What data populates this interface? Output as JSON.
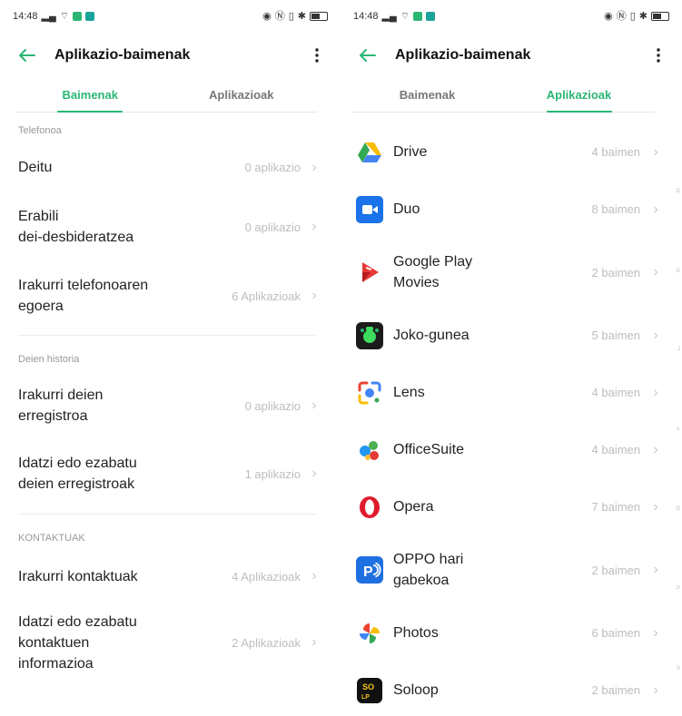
{
  "left": {
    "status": {
      "time": "14:48"
    },
    "appbar": {
      "title": "Aplikazio-baimenak"
    },
    "tabs": [
      {
        "label": "Baimenak",
        "active": true
      },
      {
        "label": "Aplikazioak",
        "active": false
      }
    ],
    "sections": [
      {
        "header": "Telefonoa",
        "items": [
          {
            "label": "Deitu",
            "value": "0 aplikazio"
          },
          {
            "label": "Erabili\ndei-desbideratzea",
            "value": "0 aplikazio"
          },
          {
            "label": "Irakurri telefonoaren\negoera",
            "value": "6 Aplikazioak"
          }
        ]
      },
      {
        "header": "Deien historia",
        "items": [
          {
            "label": "Irakurri deien\nerregistroa",
            "value": "0 aplikazio"
          },
          {
            "label": "Idatzi edo ezabatu\ndeien erregistroak",
            "value": "1 aplikazio"
          }
        ]
      },
      {
        "header": "KONTAKTUAK",
        "items": [
          {
            "label": "Irakurri kontaktuak",
            "value": "4 Aplikazioak"
          },
          {
            "label": "Idatzi edo ezabatu\nkontaktuen\ninformazioa",
            "value": "2 Aplikazioak"
          }
        ]
      }
    ]
  },
  "right": {
    "status": {
      "time": "14:48"
    },
    "appbar": {
      "title": "Aplikazio-baimenak"
    },
    "tabs": [
      {
        "label": "Baimenak",
        "active": false
      },
      {
        "label": "Aplikazioak",
        "active": true
      }
    ],
    "apps": [
      {
        "name": "Drive",
        "value": "4 baimen",
        "icon": "drive-icon"
      },
      {
        "name": "Duo",
        "value": "8 baimen",
        "icon": "duo-icon"
      },
      {
        "name": "Google Play\nMovies",
        "value": "2 baimen",
        "icon": "play-movies-icon"
      },
      {
        "name": "Joko-gunea",
        "value": "5 baimen",
        "icon": "joko-gunea-icon"
      },
      {
        "name": "Lens",
        "value": "4 baimen",
        "icon": "lens-icon"
      },
      {
        "name": "OfficeSuite",
        "value": "4 baimen",
        "icon": "officesuite-icon"
      },
      {
        "name": "Opera",
        "value": "7 baimen",
        "icon": "opera-icon"
      },
      {
        "name": "OPPO hari\ngabekoa",
        "value": "2 baimen",
        "icon": "oppo-wireless-icon"
      },
      {
        "name": "Photos",
        "value": "6 baimen",
        "icon": "photos-icon"
      },
      {
        "name": "Soloop",
        "value": "2 baimen",
        "icon": "soloop-icon"
      }
    ],
    "index_letters": [
      "D",
      "G",
      "J",
      "L",
      "O",
      "P",
      "S"
    ]
  },
  "colors": {
    "accent": "#2bb673",
    "muted": "#bdbdbd"
  }
}
